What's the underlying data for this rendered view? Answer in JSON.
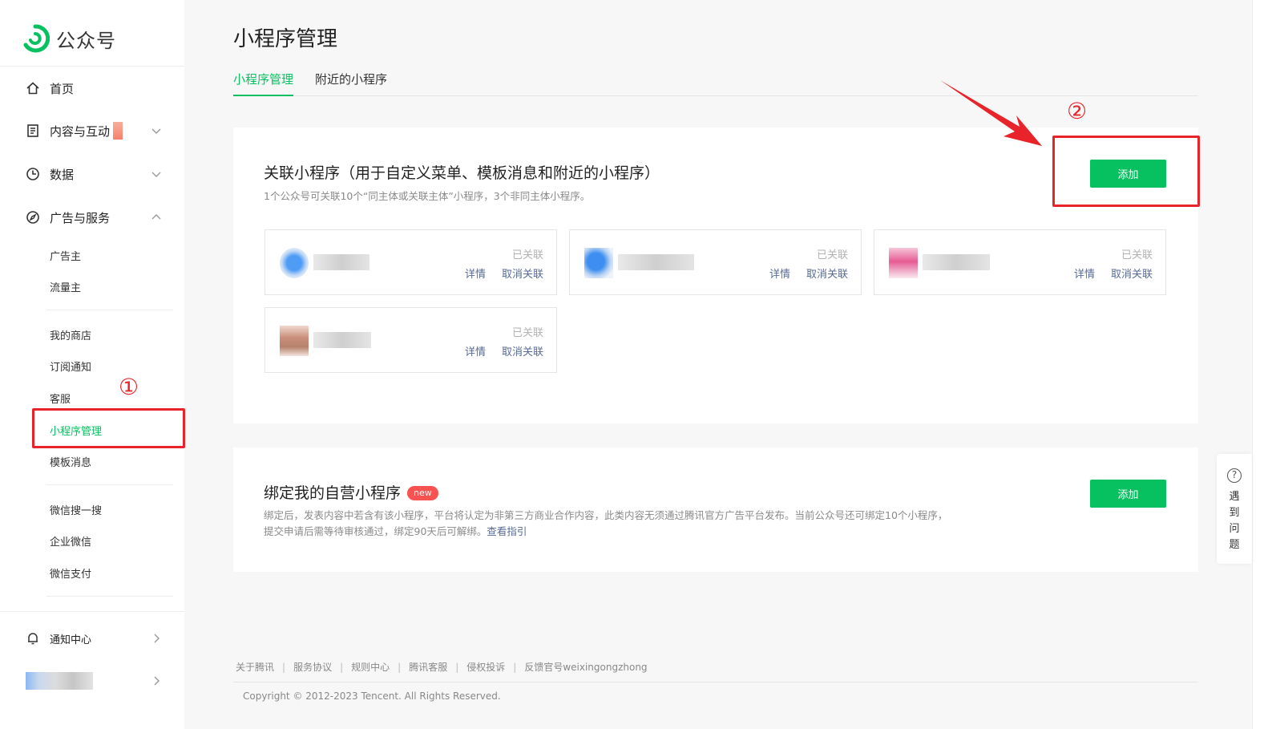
{
  "brand": {
    "name": "公众号",
    "color": "#07c160"
  },
  "sidebar": {
    "top_items": [
      {
        "label": "首页",
        "icon": "home-icon"
      },
      {
        "label": "内容与互动",
        "icon": "document-icon"
      },
      {
        "label": "数据",
        "icon": "clock-icon"
      },
      {
        "label": "广告与服务",
        "icon": "compass-icon"
      }
    ],
    "ad_sub": [
      "广告主",
      "流量主"
    ],
    "feature_sub": [
      "我的商店",
      "订阅通知",
      "客服",
      "小程序管理",
      "模板消息"
    ],
    "other_sub": [
      "微信搜一搜",
      "企业微信",
      "微信支付"
    ],
    "notice": {
      "label": "通知中心",
      "icon": "bell-icon"
    }
  },
  "page": {
    "title": "小程序管理",
    "tabs": [
      {
        "label": "小程序管理",
        "active": true
      },
      {
        "label": "附近的小程序",
        "active": false
      }
    ]
  },
  "linked_section": {
    "title": "关联小程序（用于自定义菜单、模板消息和附近的小程序）",
    "desc": "1个公众号可关联10个“同主体或关联主体”小程序，3个非同主体小程序。",
    "add_label": "添加",
    "items": [
      {
        "status": "已关联",
        "detail": "详情",
        "unlink": "取消关联"
      },
      {
        "status": "已关联",
        "detail": "详情",
        "unlink": "取消关联"
      },
      {
        "status": "已关联",
        "detail": "详情",
        "unlink": "取消关联"
      },
      {
        "status": "已关联",
        "detail": "详情",
        "unlink": "取消关联"
      }
    ]
  },
  "bind_section": {
    "title": "绑定我的自营小程序",
    "badge": "new",
    "desc_line1": "绑定后，发表内容中若含有该小程序，平台将认定为非第三方商业合作内容，此类内容无须通过腾讯官方广告平台发布。当前公众号还可绑定10个小程序，",
    "desc_line2": "提交申请后需等待审核通过，绑定90天后可解绑。",
    "guide_link": "查看指引",
    "add_label": "添加"
  },
  "footer": {
    "links": [
      "关于腾讯",
      "服务协议",
      "规则中心",
      "腾讯客服",
      "侵权投诉",
      "反馈官号weixingongzhong"
    ],
    "copyright": "Copyright © 2012-2023 Tencent. All Rights Reserved."
  },
  "help": {
    "text": "遇到问题",
    "icon": "question-icon"
  },
  "annotations": {
    "one": "①",
    "two": "②",
    "color": "#e8242a"
  }
}
